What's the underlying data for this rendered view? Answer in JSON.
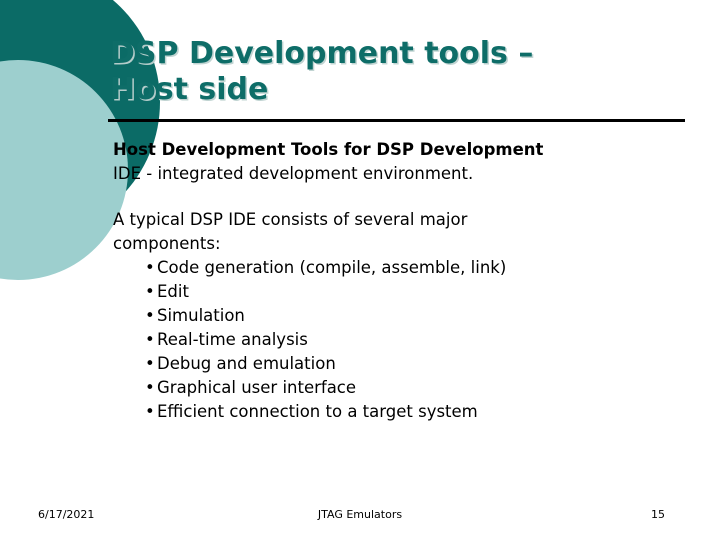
{
  "slide": {
    "title_lines": [
      "DSP Development tools –",
      "Host side"
    ],
    "accent_color": "#0b6b66",
    "accent_light_color": "#9dcfce",
    "divider_color": "#000000",
    "background_color": "#ffffff"
  },
  "body": {
    "heading": "Host Development Tools for DSP Development",
    "subheading": "IDE - integrated development environment.",
    "intro_lines": [
      "A typical DSP IDE consists of several major",
      "components:"
    ],
    "bullet_char": "•",
    "bullets": [
      "Code generation (compile, assemble, link)",
      "Edit",
      "Simulation",
      "Real-time analysis",
      "Debug and emulation",
      "Graphical user interface",
      "Efficient connection to a target system"
    ]
  },
  "footer": {
    "date": "6/17/2021",
    "center": "JTAG Emulators",
    "page_number": "15"
  }
}
